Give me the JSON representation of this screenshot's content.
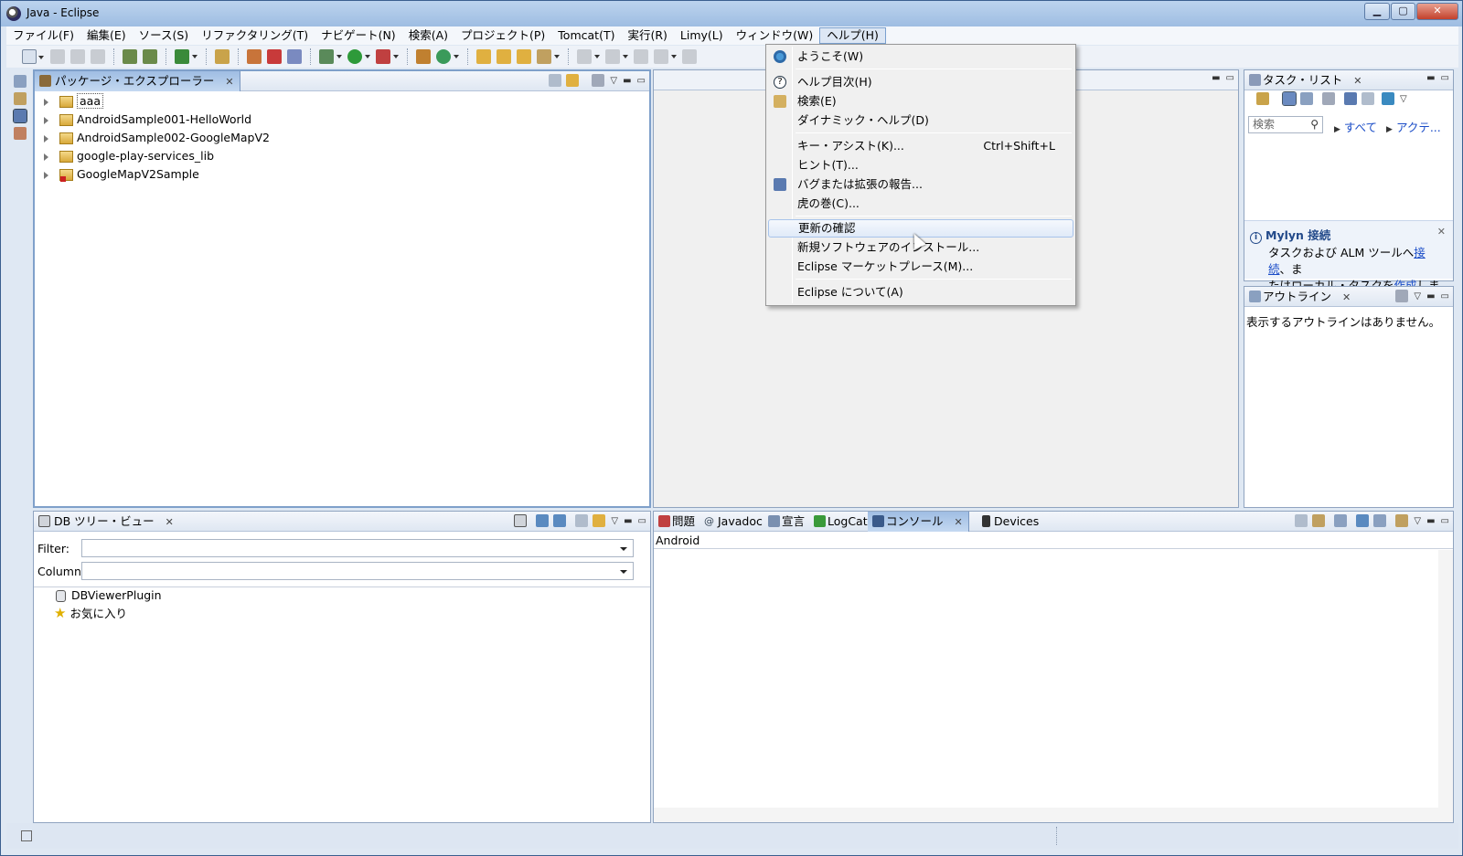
{
  "window": {
    "title": "Java - Eclipse"
  },
  "menubar": {
    "items": [
      "ファイル(F)",
      "編集(E)",
      "ソース(S)",
      "リファクタリング(T)",
      "ナビゲート(N)",
      "検索(A)",
      "プロジェクト(P)",
      "Tomcat(T)",
      "実行(R)",
      "Limy(L)",
      "ウィンドウ(W)",
      "ヘルプ(H)"
    ],
    "active": "ヘルプ(H)"
  },
  "help_menu": {
    "items": [
      {
        "label": "ようこそ(W)",
        "icon": "welcome-icon"
      },
      {
        "label": "ヘルプ目次(H)",
        "icon": "help-contents-icon"
      },
      {
        "label": "検索(E)",
        "icon": "help-search-icon"
      },
      {
        "label": "ダイナミック・ヘルプ(D)"
      },
      {
        "label": "キー・アシスト(K)...",
        "shortcut": "Ctrl+Shift+L"
      },
      {
        "label": "ヒント(T)..."
      },
      {
        "label": "バグまたは拡張の報告...",
        "icon": "report-bug-icon"
      },
      {
        "label": "虎の巻(C)..."
      },
      {
        "label": "更新の確認",
        "highlighted": true
      },
      {
        "label": "新規ソフトウェアのインストール..."
      },
      {
        "label": "Eclipse マーケットプレース(M)..."
      },
      {
        "label": "Eclipse について(A)"
      }
    ]
  },
  "package_explorer": {
    "tab": "パッケージ・エクスプローラー",
    "projects": [
      "aaa",
      "AndroidSample001-HelloWorld",
      "AndroidSample002-GoogleMapV2",
      "google-play-services_lib",
      "GoogleMapV2Sample"
    ]
  },
  "db_tree": {
    "tab": "DB ツリー・ビュー",
    "filter_label": "Filter:",
    "column_label": "Column:",
    "items": [
      "DBViewerPlugin",
      "お気に入り"
    ]
  },
  "bottom_tabs": {
    "tabs": [
      "問題",
      "Javadoc",
      "宣言",
      "LogCat",
      "コンソール",
      "Devices"
    ],
    "active": "コンソール",
    "console_name": "Android"
  },
  "task_list": {
    "tab": "タスク・リスト",
    "search_placeholder": "検索",
    "filter_all": "すべて",
    "filter_active": "アクテ..."
  },
  "mylyn": {
    "title": "Mylyn 接続",
    "text_1": "タスクおよび ALM ツールへ",
    "link_connect": "接続",
    "text_2": "、ま",
    "text_3": "たはローカル・タスクを",
    "link_create": "作成",
    "text_4": "します。"
  },
  "outline": {
    "tab": "アウトライン",
    "empty_message": "表示するアウトラインはありません。"
  },
  "colors": {
    "accent": "#9fbde3",
    "link": "#1a4cc7",
    "menu_highlight": "#e0eaf8"
  }
}
